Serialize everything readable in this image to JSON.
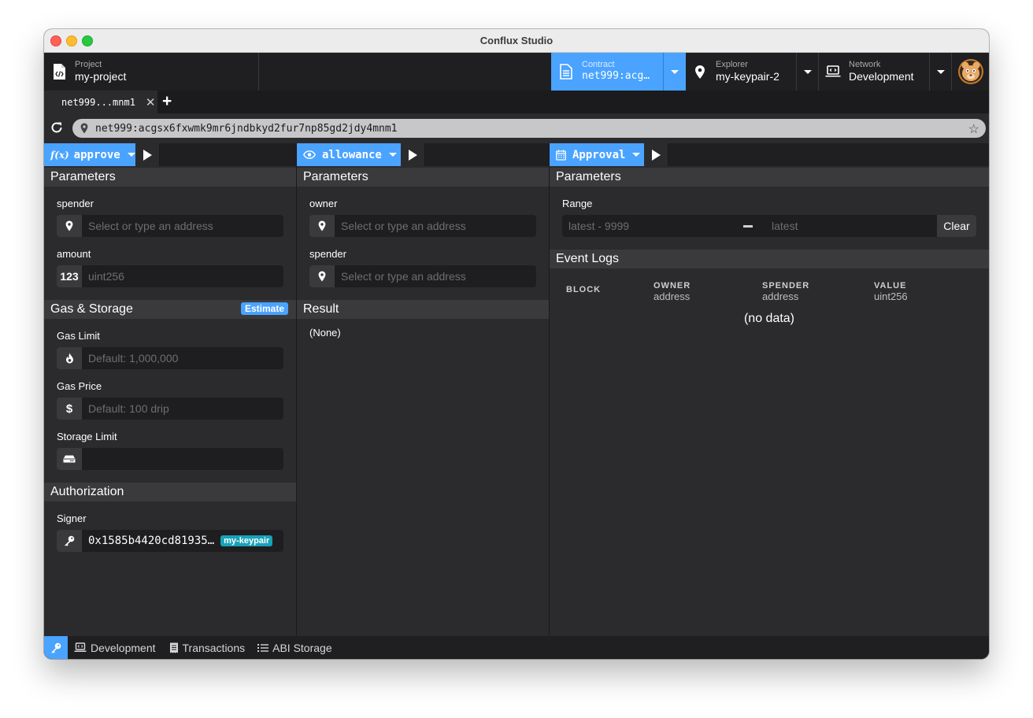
{
  "window": {
    "title": "Conflux Studio"
  },
  "header": {
    "project": {
      "label": "Project",
      "value": "my-project"
    },
    "contract": {
      "label": "Contract",
      "value": "net999:acg…"
    },
    "explorer": {
      "label": "Explorer",
      "value": "my-keypair-2"
    },
    "network": {
      "label": "Network",
      "value": "Development"
    }
  },
  "tabs": [
    {
      "label": "net999...mnm1"
    }
  ],
  "address_bar": {
    "url": "net999:acgsx6fxwmk9mr6jndbkyd2fur7np85gd2jdy4mnm1"
  },
  "panels": {
    "invoke": {
      "function_label": "approve",
      "function_icon": "f(x)",
      "parameters_title": "Parameters",
      "fields": [
        {
          "label": "spender",
          "placeholder": "Select or type an address"
        },
        {
          "label": "amount",
          "icon_text": "123",
          "placeholder": "uint256"
        }
      ],
      "gas": {
        "title": "Gas & Storage",
        "estimate_label": "Estimate",
        "fields": [
          {
            "label": "Gas Limit",
            "placeholder": "Default: 1,000,000"
          },
          {
            "label": "Gas Price",
            "placeholder": "Default: 100 drip"
          },
          {
            "label": "Storage Limit",
            "placeholder": ""
          }
        ]
      },
      "auth": {
        "title": "Authorization",
        "signer_label": "Signer",
        "signer_value": "0x1585b4420cd81935…",
        "signer_badge": "my-keypair"
      }
    },
    "view": {
      "function_label": "allowance",
      "parameters_title": "Parameters",
      "fields": [
        {
          "label": "owner",
          "placeholder": "Select or type an address"
        },
        {
          "label": "spender",
          "placeholder": "Select or type an address"
        }
      ],
      "result_title": "Result",
      "result_value": "(None)"
    },
    "event": {
      "event_label": "Approval",
      "parameters_title": "Parameters",
      "range_label": "Range",
      "range_from_placeholder": "latest - 9999",
      "range_to_placeholder": "latest",
      "clear_label": "Clear",
      "logs_title": "Event Logs",
      "columns": [
        {
          "name": "BLOCK",
          "type": ""
        },
        {
          "name": "OWNER",
          "type": "address"
        },
        {
          "name": "SPENDER",
          "type": "address"
        },
        {
          "name": "VALUE",
          "type": "uint256"
        }
      ],
      "empty_text": "(no data)"
    }
  },
  "footer": {
    "items": [
      {
        "label": "Development",
        "icon": "laptop-icon"
      },
      {
        "label": "Transactions",
        "icon": "receipt-icon"
      },
      {
        "label": "ABI Storage",
        "icon": "list-icon"
      }
    ]
  },
  "colors": {
    "accent": "#4aa3ff",
    "badge": "#17a2b8",
    "background": "#2b2b2e"
  }
}
